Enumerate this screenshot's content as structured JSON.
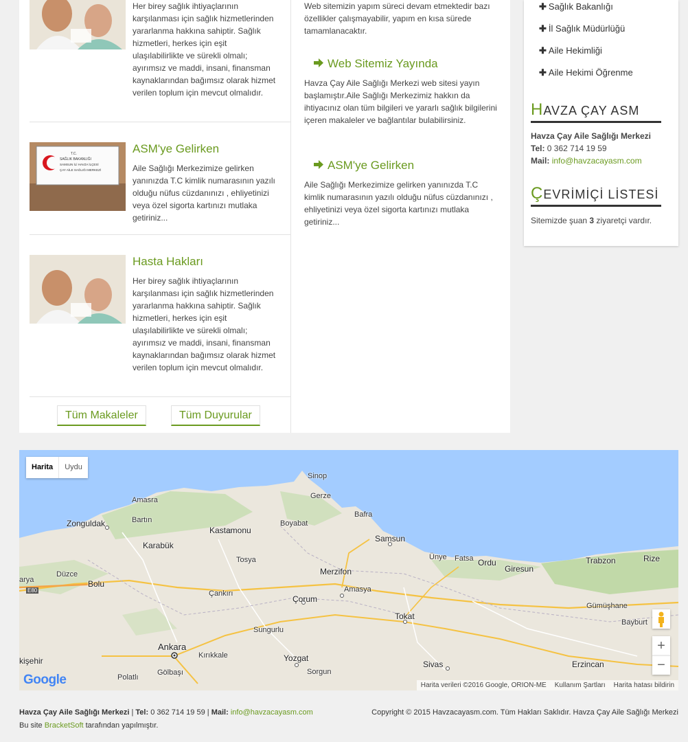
{
  "articles": [
    {
      "title": "",
      "text": "Her birey sağlık ihtiyaçlarının karşılanması için sağlık hizmetlerinden yararlanma hakkına sahiptir. Sağlık hizmetleri, herkes için eşit ulaşılabilirlikte ve sürekli olmalı; ayırımsız ve maddi, insani, finansman kaynaklarından bağımsız olarak hizmet verilen toplum için mevcut olmalıdır."
    },
    {
      "title": "ASM'ye Gelirken",
      "text": "Aile Sağlığı Merkezimize gelirken yanınızda T.C kimlik numarasının yazılı olduğu nüfus cüzdanınızı , ehliyetinizi veya özel sigorta kartınızı mutlaka getiriniz..."
    },
    {
      "title": "Hasta Hakları",
      "text": "Her birey sağlık ihtiyaçlarının karşılanması için sağlık hizmetlerinden yararlanma hakkına sahiptir. Sağlık hizmetleri, herkes için eşit ulaşılabilirlikte ve sürekli olmalı; ayırımsız ve maddi, insani, finansman kaynaklarından bağımsız olarak hizmet verilen toplum için mevcut olmalıdır."
    }
  ],
  "sign": {
    "line1": "T.C.",
    "line2": "SAĞLIK BAKANLIĞI",
    "line3": "SAMSUN İLİ HAVZA İLÇESİ",
    "line4": "ÇAY AİLE SAĞLIĞI MERKEZİ"
  },
  "buttons": {
    "all_articles": "Tüm Makaleler",
    "all_announcements": "Tüm Duyurular"
  },
  "news": [
    {
      "title": "",
      "text": "Web sitemizin yapım süreci devam etmektedir bazı özellikler çalışmayabilir, yapım en kısa sürede tamamlanacaktır."
    },
    {
      "title": "Web Sitemiz Yayında",
      "text": "Havza Çay Aile Sağlığı Merkezi web sitesi yayın başlamıştır.Aile Sağlığı Merkezimiz hakkın da ihtiyacınız olan tüm bilgileri ve yararlı sağlık bilgilerini içeren makaleler ve bağlantılar bulabilirsiniz."
    },
    {
      "title": "ASM'ye Gelirken",
      "text": "Aile Sağlığı Merkezimize gelirken yanınızda T.C kimlik numarasının yazılı olduğu nüfus cüzdanınızı , ehliyetinizi veya özel sigorta kartınızı mutlaka getiriniz..."
    }
  ],
  "sidebar": {
    "links": [
      "Sağlık Bakanlığı",
      "İl Sağlık Müdürlüğü",
      "Aile Hekimliği",
      "Aile Hekimi Öğrenme"
    ],
    "contact_heading_first": "H",
    "contact_heading_rest": "AVZA ÇAY ASM",
    "contact_name": "Havza Çay Aile Sağlığı Merkezi",
    "tel_label": "Tel:",
    "tel": "0 362 714 19 59",
    "mail_label": "Mail:",
    "mail": "info@havzacayasm.com",
    "online_heading_first": "Ç",
    "online_heading_rest": "EVRİMİÇİ LİSTESİ",
    "online_pre": "Sitemizde şuan",
    "online_count": "3",
    "online_post": "ziyaretçi vardır."
  },
  "map": {
    "type_map": "Harita",
    "type_sat": "Uydu",
    "zoom_in": "+",
    "zoom_out": "−",
    "data_credit": "Harita verileri ©2016 Google, ORION-ME",
    "terms": "Kullanım Şartları",
    "report": "Harita hatası bildirin",
    "logo": "Google",
    "road_label": "E80",
    "places": [
      "Sinop",
      "Gerze",
      "Amasra",
      "Bartın",
      "Zonguldak",
      "Bafra",
      "Boyabat",
      "Kastamonu",
      "Karabük",
      "Samsun",
      "Ünye",
      "Fatsa",
      "Ordu",
      "Giresun",
      "Trabzon",
      "Rize",
      "Düzce",
      "Tosya",
      "Merzifon",
      "Bolu",
      "Amasya",
      "Çankırı",
      "Çorum",
      "Gümüşhane",
      "Tokat",
      "Bayburt",
      "Sungurlu",
      "Ankara",
      "Kırıkkale",
      "Yozgat",
      "Sivas",
      "Erzincan",
      "kişehir",
      "Gölbaşı",
      "Sorgun",
      "Polatlı",
      "arya"
    ]
  },
  "footer": {
    "name": "Havza Çay Aile Sağlığı Merkezi",
    "sep1": " | ",
    "tel_label": "Tel:",
    "tel": "0 362 714 19 59",
    "sep2": " | ",
    "mail_label": "Mail:",
    "mail": "info@havzacayasm.com",
    "credit_pre": "Bu site",
    "credit_link": "BracketSoft",
    "credit_post": "tarafından yapılmıştır.",
    "copyright": "Copyright © 2015 Havzacayasm.com. Tüm Hakları Saklıdır. Havza Çay Aile Sağlığı Merkezi"
  }
}
